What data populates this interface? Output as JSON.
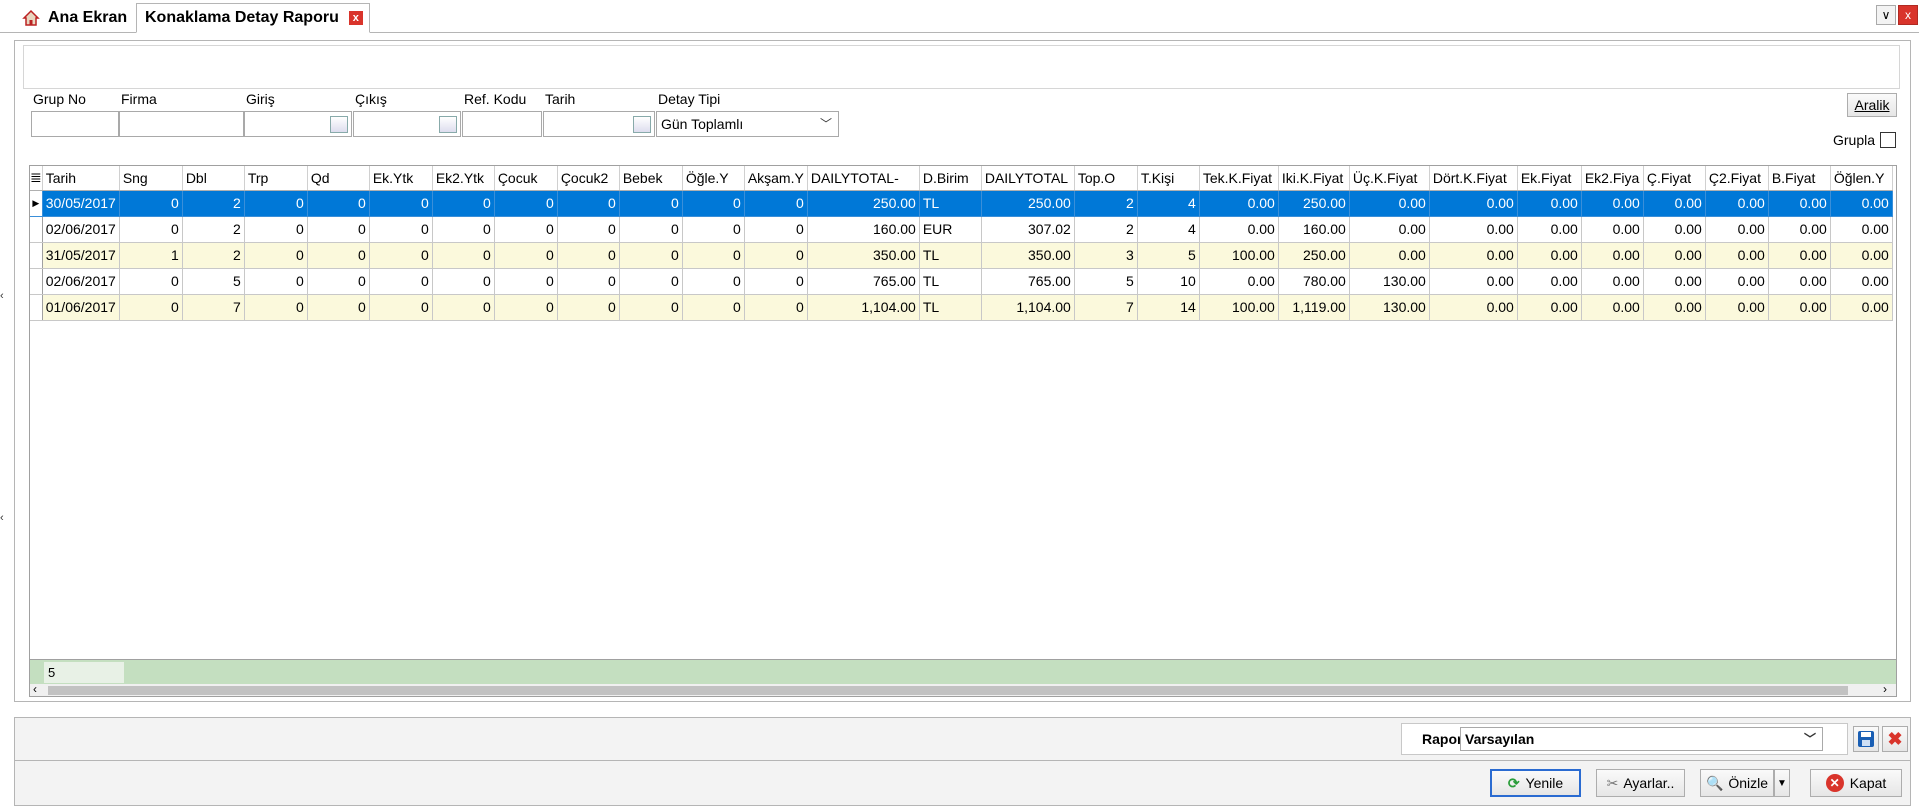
{
  "tabs": [
    {
      "label": "Ana Ekran",
      "icon": "home-icon"
    },
    {
      "label": "Konaklama Detay Raporu",
      "close": "x"
    }
  ],
  "window": {
    "min": "∨",
    "close": "x"
  },
  "filters": {
    "grup_no": "Grup No",
    "firma": "Firma",
    "giris": "Giriş",
    "cikis": "Çıkış",
    "ref_kodu": "Ref. Kodu",
    "tarih": "Tarih",
    "detay_tipi": "Detay Tipi",
    "detay_tipi_value": "Gün Toplamlı",
    "aralik": "Aralik",
    "grupla": "Grupla"
  },
  "grid": {
    "columns": [
      "Tarih",
      "Sng",
      "Dbl",
      "Trp",
      "Qd",
      "Ek.Ytk",
      "Ek2.Ytk",
      "Çocuk",
      "Çocuk2",
      "Bebek",
      "Öğle.Y",
      "Akşam.Y",
      "DAILYTOTAL-",
      "D.Birim",
      "DAILYTOTAL",
      "Top.O",
      "T.Kişi",
      "Tek.K.Fiyat",
      "Iki.K.Fiyat",
      "Üç.K.Fiyat",
      "Dört.K.Fiyat",
      "Ek.Fiyat",
      "Ek2.Fiya",
      "Ç.Fiyat",
      "Ç2.Fiyat",
      "B.Fiyat",
      "Öğlen.Y"
    ],
    "rows": [
      [
        "30/05/2017",
        "0",
        "2",
        "0",
        "0",
        "0",
        "0",
        "0",
        "0",
        "0",
        "0",
        "0",
        "250.00",
        "TL",
        "250.00",
        "2",
        "4",
        "0.00",
        "250.00",
        "0.00",
        "0.00",
        "0.00",
        "0.00",
        "0.00",
        "0.00",
        "0.00",
        "0.00"
      ],
      [
        "02/06/2017",
        "0",
        "2",
        "0",
        "0",
        "0",
        "0",
        "0",
        "0",
        "0",
        "0",
        "0",
        "160.00",
        "EUR",
        "307.02",
        "2",
        "4",
        "0.00",
        "160.00",
        "0.00",
        "0.00",
        "0.00",
        "0.00",
        "0.00",
        "0.00",
        "0.00",
        "0.00"
      ],
      [
        "31/05/2017",
        "1",
        "2",
        "0",
        "0",
        "0",
        "0",
        "0",
        "0",
        "0",
        "0",
        "0",
        "350.00",
        "TL",
        "350.00",
        "3",
        "5",
        "100.00",
        "250.00",
        "0.00",
        "0.00",
        "0.00",
        "0.00",
        "0.00",
        "0.00",
        "0.00",
        "0.00"
      ],
      [
        "02/06/2017",
        "0",
        "5",
        "0",
        "0",
        "0",
        "0",
        "0",
        "0",
        "0",
        "0",
        "0",
        "765.00",
        "TL",
        "765.00",
        "5",
        "10",
        "0.00",
        "780.00",
        "130.00",
        "0.00",
        "0.00",
        "0.00",
        "0.00",
        "0.00",
        "0.00",
        "0.00"
      ],
      [
        "01/06/2017",
        "0",
        "7",
        "0",
        "0",
        "0",
        "0",
        "0",
        "0",
        "0",
        "0",
        "0",
        "1,104.00",
        "TL",
        "1,104.00",
        "7",
        "14",
        "100.00",
        "1,119.00",
        "130.00",
        "0.00",
        "0.00",
        "0.00",
        "0.00",
        "0.00",
        "0.00",
        "0.00"
      ]
    ],
    "footer_count": "5"
  },
  "report": {
    "label": "Rapor",
    "value": "Varsayılan"
  },
  "buttons": {
    "yenile": "Yenile",
    "ayarlar": "Ayarlar..",
    "onizle": "Önizle",
    "kapat": "Kapat"
  },
  "colors": {
    "selection": "#0078d7",
    "alt_row": "#fbf9dc",
    "footer": "#c4dfc0",
    "close_red": "#d9342b"
  }
}
